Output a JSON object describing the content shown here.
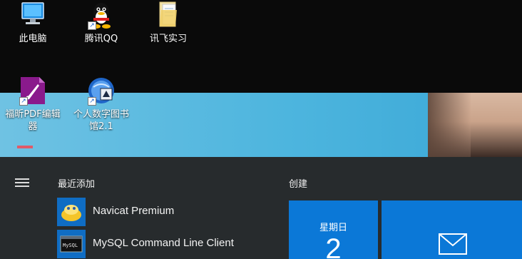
{
  "desktop": {
    "icons": [
      {
        "label": "此电脑",
        "icon": "computer-icon"
      },
      {
        "label": "腾讯QQ",
        "icon": "qq-penguin-icon"
      },
      {
        "label": "讯飞实习",
        "icon": "folder-icon"
      },
      {
        "label": "福昕PDF编辑器",
        "icon": "foxit-pdf-icon"
      },
      {
        "label": "个人数字图书馆2.1",
        "icon": "digital-library-icon"
      }
    ],
    "colors": {
      "sky": "#4db5de",
      "wallpaper_dark": "#0a0a0a"
    }
  },
  "start_menu": {
    "recently_added_title": "最近添加",
    "create_title": "创建",
    "apps": [
      {
        "label": "Navicat Premium",
        "icon": "navicat-icon"
      },
      {
        "label": "MySQL Command Line Client",
        "icon": "mysql-console-icon"
      }
    ],
    "tiles": {
      "calendar": {
        "day": "星期日",
        "date": "2"
      },
      "mail": {
        "icon": "mail-icon"
      }
    },
    "colors": {
      "background": "#2a2e30",
      "tile": "#0b78d7"
    }
  }
}
